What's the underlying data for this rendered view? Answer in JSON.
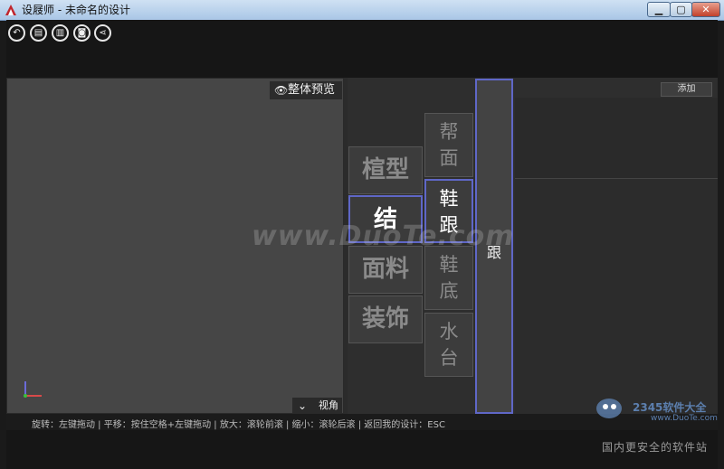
{
  "window": {
    "title": "设屐师 - 未命名的设计",
    "buttons": {
      "minimize": "▁",
      "maximize": "▢",
      "close": "✕"
    }
  },
  "toolbar": [
    {
      "name": "undo-icon",
      "glyph": "↶"
    },
    {
      "name": "save-icon",
      "glyph": "▤"
    },
    {
      "name": "save-as-icon",
      "glyph": "▥"
    },
    {
      "name": "camera-icon",
      "glyph": "◙"
    },
    {
      "name": "share-icon",
      "glyph": "⋖"
    }
  ],
  "viewport": {
    "preview_label": "整体预览",
    "eye_icon": "eye-icon",
    "view_angle_label": "视角",
    "chevron_icon": "chevron-down-icon"
  },
  "menu": {
    "level1": [
      {
        "label": "楦型",
        "active": false
      },
      {
        "label": "结",
        "active": true
      },
      {
        "label": "面料",
        "active": false
      },
      {
        "label": "装饰",
        "active": false
      }
    ],
    "level2": [
      {
        "line1": "帮",
        "line2": "面",
        "active": false
      },
      {
        "line1": "鞋",
        "line2": "跟",
        "active": true
      },
      {
        "line1": "鞋",
        "line2": "底",
        "active": false
      },
      {
        "line1": "水",
        "line2": "台",
        "active": false
      }
    ],
    "level3": "跟",
    "active_color": "#5f67c7"
  },
  "add_label": "添加",
  "status": "旋转：左键拖动 | 平移：按住空格+左键拖动 | 放大：滚轮前滚 | 缩小：滚轮后滚 | 返回我的设计：ESC",
  "watermark": {
    "text": "www.DuoTe.com",
    "brand": "2345软件大全",
    "url": "www.DuoTe.com",
    "tagline": "国内更安全的软件站"
  }
}
